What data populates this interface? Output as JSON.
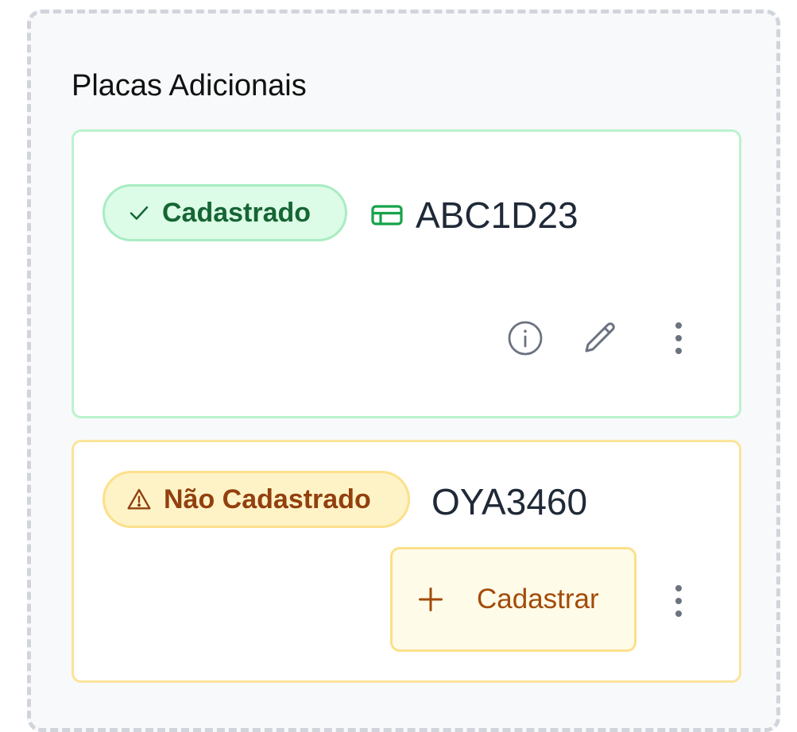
{
  "section": {
    "title": "Placas Adicionais"
  },
  "plates": [
    {
      "status_label": "Cadastrado",
      "status_icon": "check-icon",
      "plate_icon": "plate-card-icon",
      "plate_number": "ABC1D23",
      "actions": [
        "info-icon",
        "pencil-icon",
        "kebab-menu-icon"
      ]
    },
    {
      "status_label": "Não Cadastrado",
      "status_icon": "warning-triangle-icon",
      "plate_number": "OYA3460",
      "register_label": "Cadastrar",
      "register_icon": "plus-icon",
      "actions": [
        "kebab-menu-icon"
      ]
    }
  ],
  "colors": {
    "success_bg": "#dcfce7",
    "success_text": "#166534",
    "warning_bg": "#fef3c7",
    "warning_text": "#92400e",
    "register_text": "#a34b09",
    "icon_gray": "#6b7280"
  }
}
